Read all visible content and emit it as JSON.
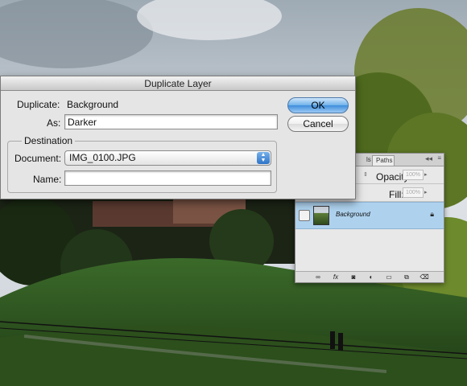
{
  "dialog": {
    "title": "Duplicate Layer",
    "duplicate_label": "Duplicate:",
    "duplicate_value": "Background",
    "as_label": "As:",
    "as_value": "Darker",
    "destination_label": "Destination",
    "document_label": "Document:",
    "document_value": "IMG_0100.JPG",
    "name_label": "Name:",
    "name_value": "",
    "ok_label": "OK",
    "cancel_label": "Cancel"
  },
  "layers_panel": {
    "tabs": [
      "ls",
      "Paths"
    ],
    "opacity_label": "Opacity:",
    "opacity_value": "100%",
    "fill_label": "Fill:",
    "fill_value": "100%",
    "layer_name": "Background",
    "footer_icons": [
      "link-icon",
      "fx-icon",
      "mask-icon",
      "adjustment-icon",
      "folder-icon",
      "new-layer-icon",
      "trash-icon"
    ],
    "fx_glyph": "fx"
  },
  "colors": {
    "ok_button": "#6fb1ea",
    "selected_layer": "#aed2ee",
    "popup_arrows": "#2e73c8"
  }
}
